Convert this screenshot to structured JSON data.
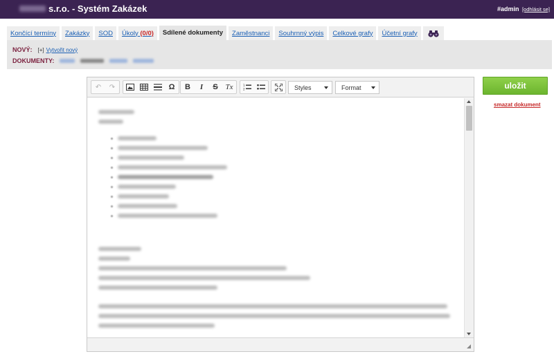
{
  "header": {
    "title": "s.r.o. - Systém Zakázek",
    "user": "#admin",
    "logout": "[odhlásit se]"
  },
  "tabs": [
    {
      "label": "Končící termíny"
    },
    {
      "label": "Zakázky"
    },
    {
      "label": "SOD"
    },
    {
      "label": "Úkoly",
      "count": "(0/0)"
    },
    {
      "label": "Sdílené dokumenty",
      "active": true
    },
    {
      "label": "Zaměstnanci"
    },
    {
      "label": "Souhrnný výpis"
    },
    {
      "label": "Celkové grafy"
    },
    {
      "label": "Účetní grafy"
    },
    {
      "icon": "binoculars-icon"
    }
  ],
  "subpanel": {
    "new_label": "NOVÝ:",
    "new_plus": "[+]",
    "new_link": "Vytvořit nový",
    "docs_label": "DOKUMENTY:"
  },
  "editor": {
    "toolbar": {
      "styles_label": "Styles",
      "format_label": "Format",
      "bold": "B",
      "italic": "I",
      "strike": "S",
      "removeformat": "Tx",
      "special_char": "Ω"
    }
  },
  "actions": {
    "save": "uložit",
    "delete": "smazat dokument"
  },
  "colors": {
    "header_bg": "#3b2352",
    "link": "#1a5fb4",
    "label": "#7a1f3d",
    "save": "#7dc23a",
    "delete": "#c62828"
  }
}
